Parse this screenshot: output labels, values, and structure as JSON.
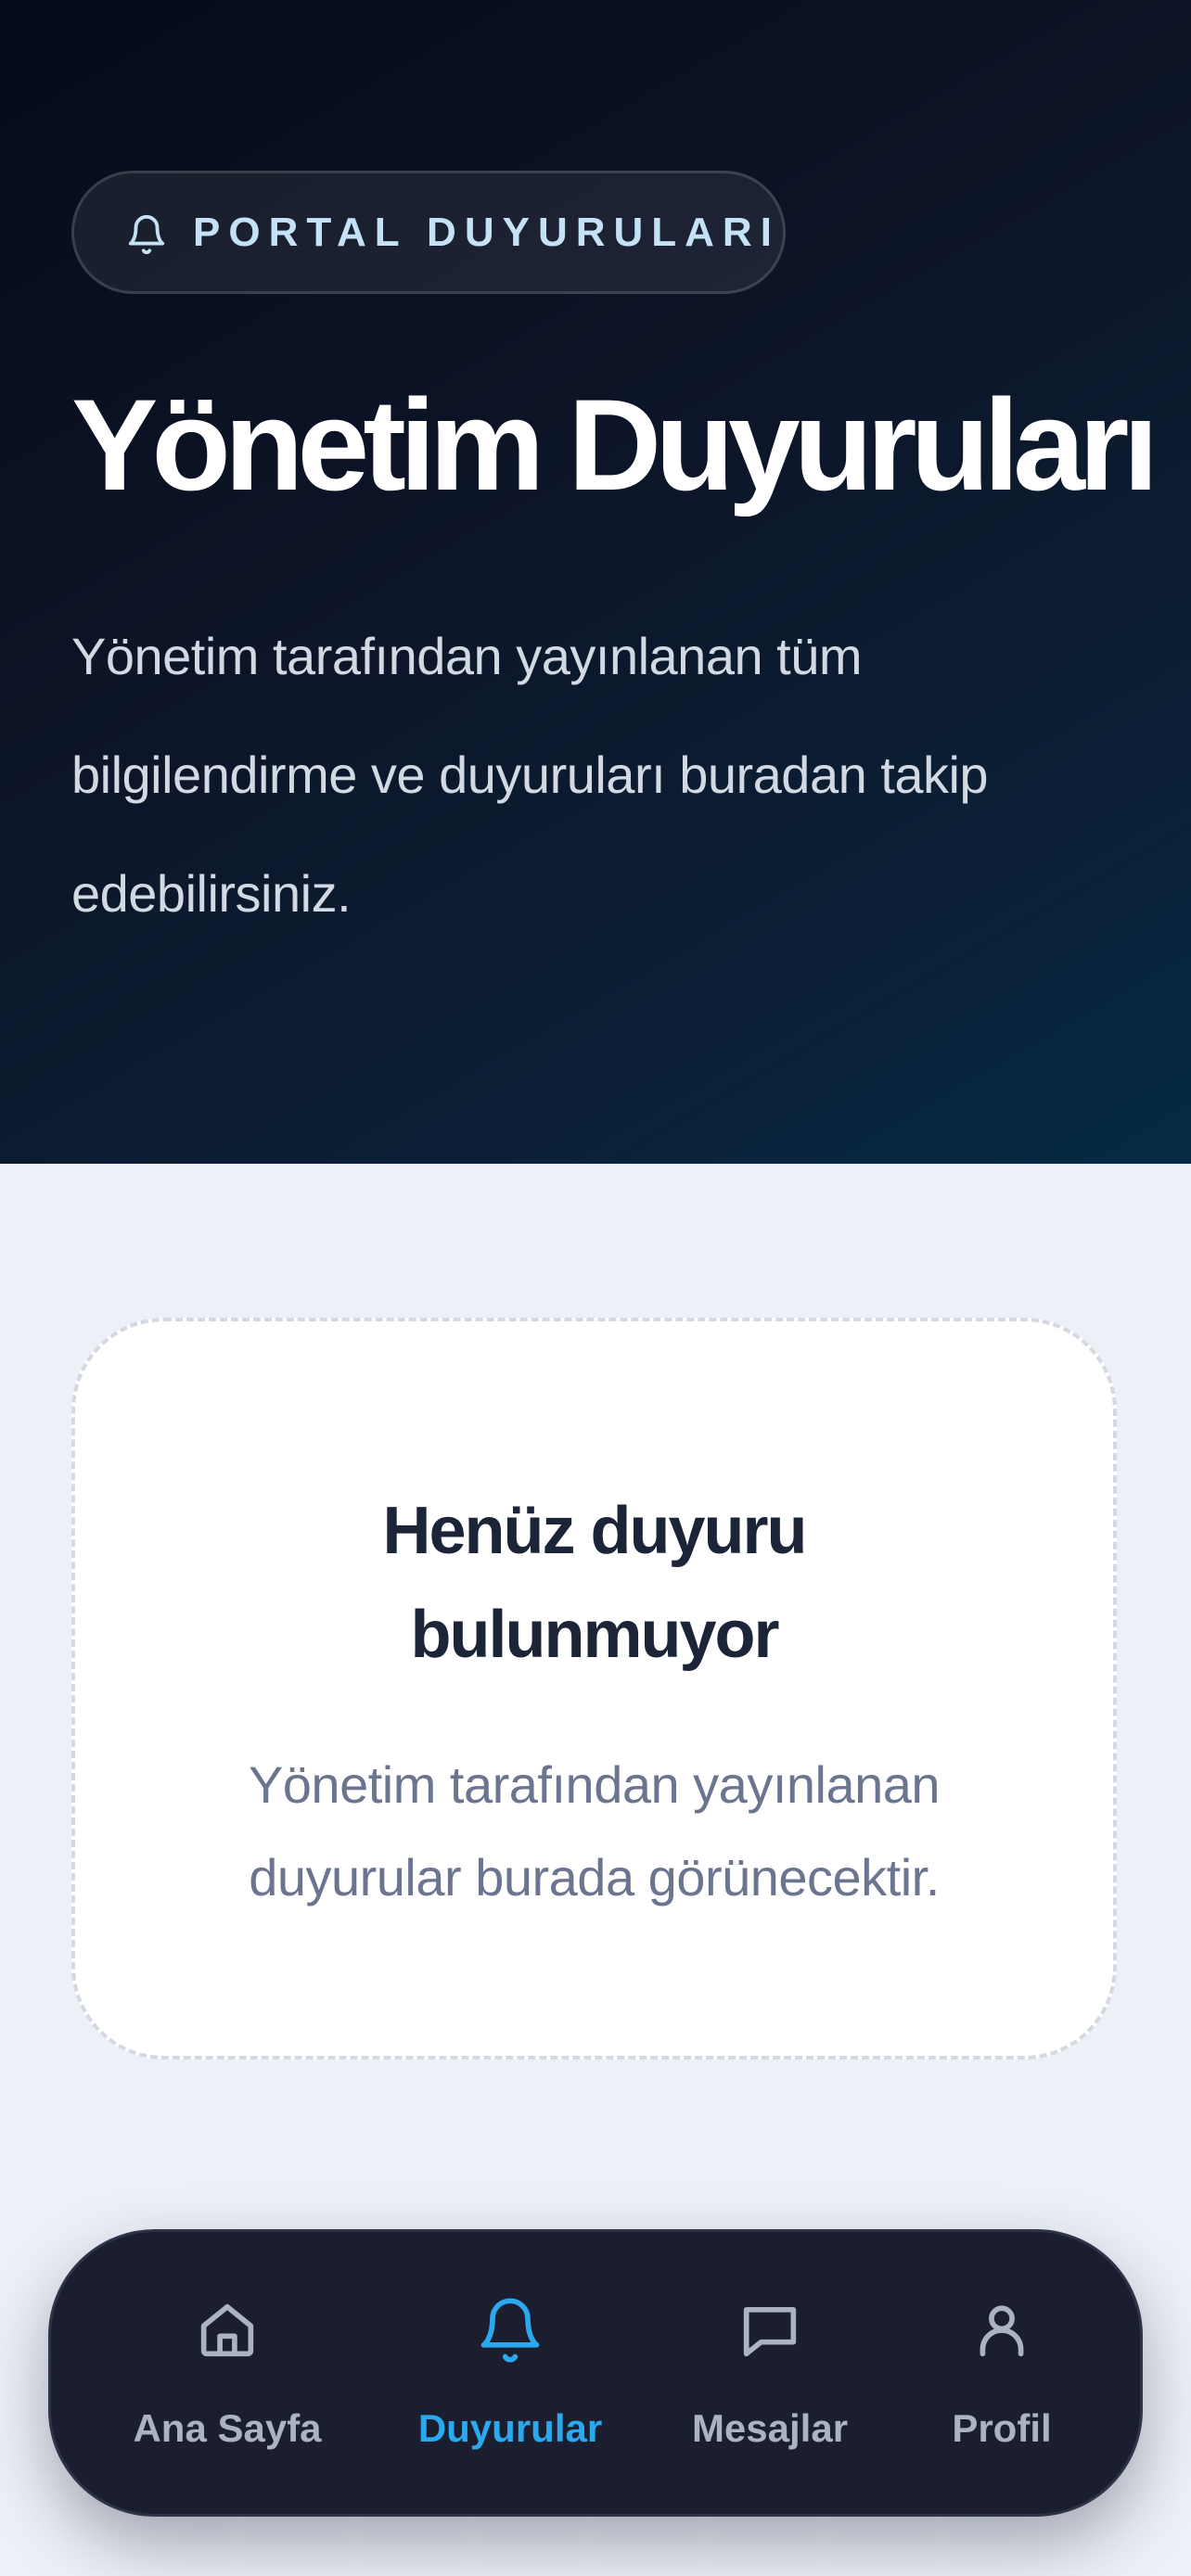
{
  "hero": {
    "badge_label": "PORTAL DUYURULARI",
    "badge_icon": "bell-icon",
    "title": "Yönetim Duyuruları",
    "description": "Yönetim tarafından yayınlanan tüm bilgilendirme ve duyuruları buradan takip edebilirsiniz."
  },
  "empty_state": {
    "title_line1": "Henüz duyuru",
    "title_line2": "bulunmuyor",
    "description_line1": "Yönetim tarafından yayınlanan",
    "description_line2": "duyurular burada görünecektir."
  },
  "tab_bar": {
    "active_tab": "Duyurular",
    "tabs": [
      {
        "label": "Ana Sayfa",
        "icon": "home-icon"
      },
      {
        "label": "Duyurular",
        "icon": "bell-icon"
      },
      {
        "label": "Mesajlar",
        "icon": "message-icon"
      },
      {
        "label": "Profil",
        "icon": "user-icon"
      }
    ]
  },
  "colors": {
    "accent": "#2aa9ef",
    "hero_background": "#0b1424",
    "tab_bar_background": "#1a1e2f",
    "page_background": "#edf0f7"
  }
}
